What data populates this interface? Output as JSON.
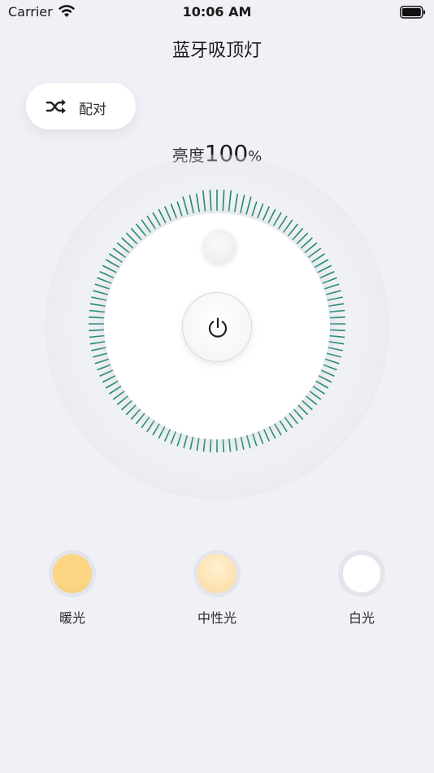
{
  "status_bar": {
    "carrier": "Carrier",
    "time": "10:06 AM"
  },
  "nav": {
    "title": "蓝牙吸顶灯"
  },
  "pair_button": {
    "label": "配对"
  },
  "brightness": {
    "label": "亮度",
    "value": "100",
    "unit": "%",
    "level": 1.0
  },
  "colors": {
    "accent": "#1f8a6a",
    "background": "#f0f1f6"
  },
  "color_modes": [
    {
      "label": "暖光",
      "color": "#fbd582",
      "icon": "warm-light-swatch"
    },
    {
      "label": "中性光",
      "color": "#fde2b0",
      "icon": "neutral-light-swatch"
    },
    {
      "label": "白光",
      "color": "#ffffff",
      "icon": "white-light-swatch"
    }
  ]
}
